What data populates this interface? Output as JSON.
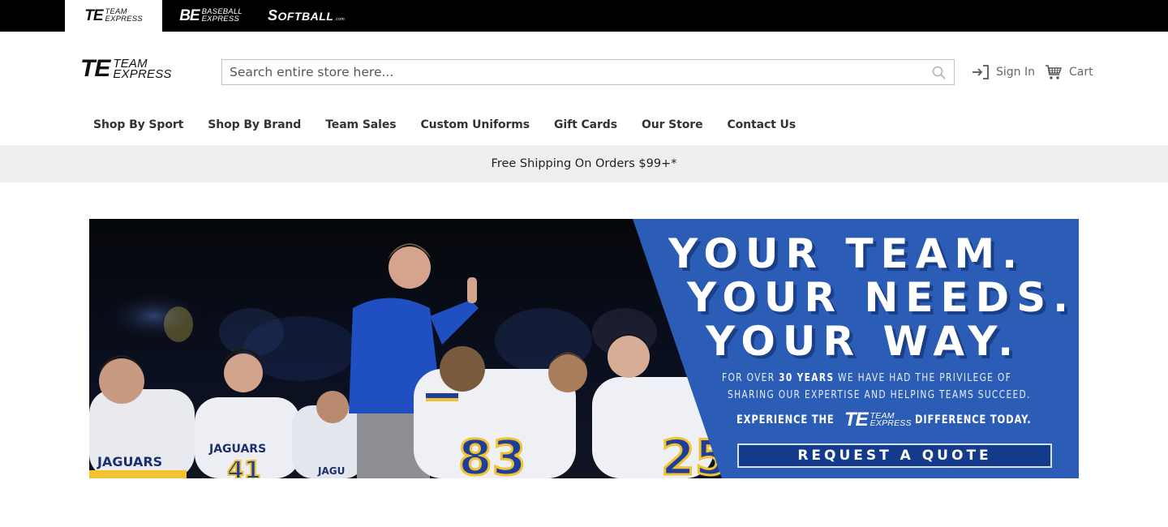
{
  "brand_strip": {
    "tabs": [
      {
        "id": "team-express",
        "monogram": "TE",
        "line1": "TEAM",
        "line2": "EXPRESS",
        "active": true
      },
      {
        "id": "baseball-express",
        "monogram": "BE",
        "line1": "BASEBALL",
        "line2": "EXPRESS",
        "active": false
      },
      {
        "id": "softball",
        "first": "S",
        "rest": "OFTBALL",
        "suffix": ".com",
        "active": false
      }
    ]
  },
  "header": {
    "logo": {
      "monogram": "TE",
      "line1": "TEAM",
      "line2": "EXPRESS"
    },
    "search": {
      "placeholder": "Search entire store here...",
      "value": ""
    },
    "sign_in_label": "Sign In",
    "cart_label": "Cart"
  },
  "nav": {
    "items": [
      {
        "label": "Shop By Sport"
      },
      {
        "label": "Shop By Brand"
      },
      {
        "label": "Team Sales"
      },
      {
        "label": "Custom Uniforms"
      },
      {
        "label": "Gift Cards"
      },
      {
        "label": "Our Store"
      },
      {
        "label": "Contact Us"
      }
    ]
  },
  "promo": {
    "text": "Free Shipping On Orders $99+*"
  },
  "hero": {
    "headline": [
      "YOUR TEAM.",
      "YOUR NEEDS.",
      "YOUR WAY."
    ],
    "sub_pre": "FOR OVER ",
    "sub_bold": "30 YEARS",
    "sub_post": " WE HAVE HAD THE PRIVILEGE OF",
    "sub_line2": "SHARING OUR EXPERTISE AND HELPING TEAMS SUCCEED.",
    "experience_pre": "EXPERIENCE THE",
    "experience_logo": {
      "monogram": "TE",
      "line1": "TEAM",
      "line2": "EXPRESS"
    },
    "experience_post": "DIFFERENCE TODAY.",
    "cta_label": "REQUEST A QUOTE",
    "photo_jerseys": [
      "JAGUARS",
      "41",
      "83",
      "25"
    ],
    "colors": {
      "panel_blue": "#2b5cb6",
      "cta_navy": "#143a8c",
      "jersey_gold": "#f2c230",
      "jersey_blue": "#1d3f9a"
    }
  }
}
